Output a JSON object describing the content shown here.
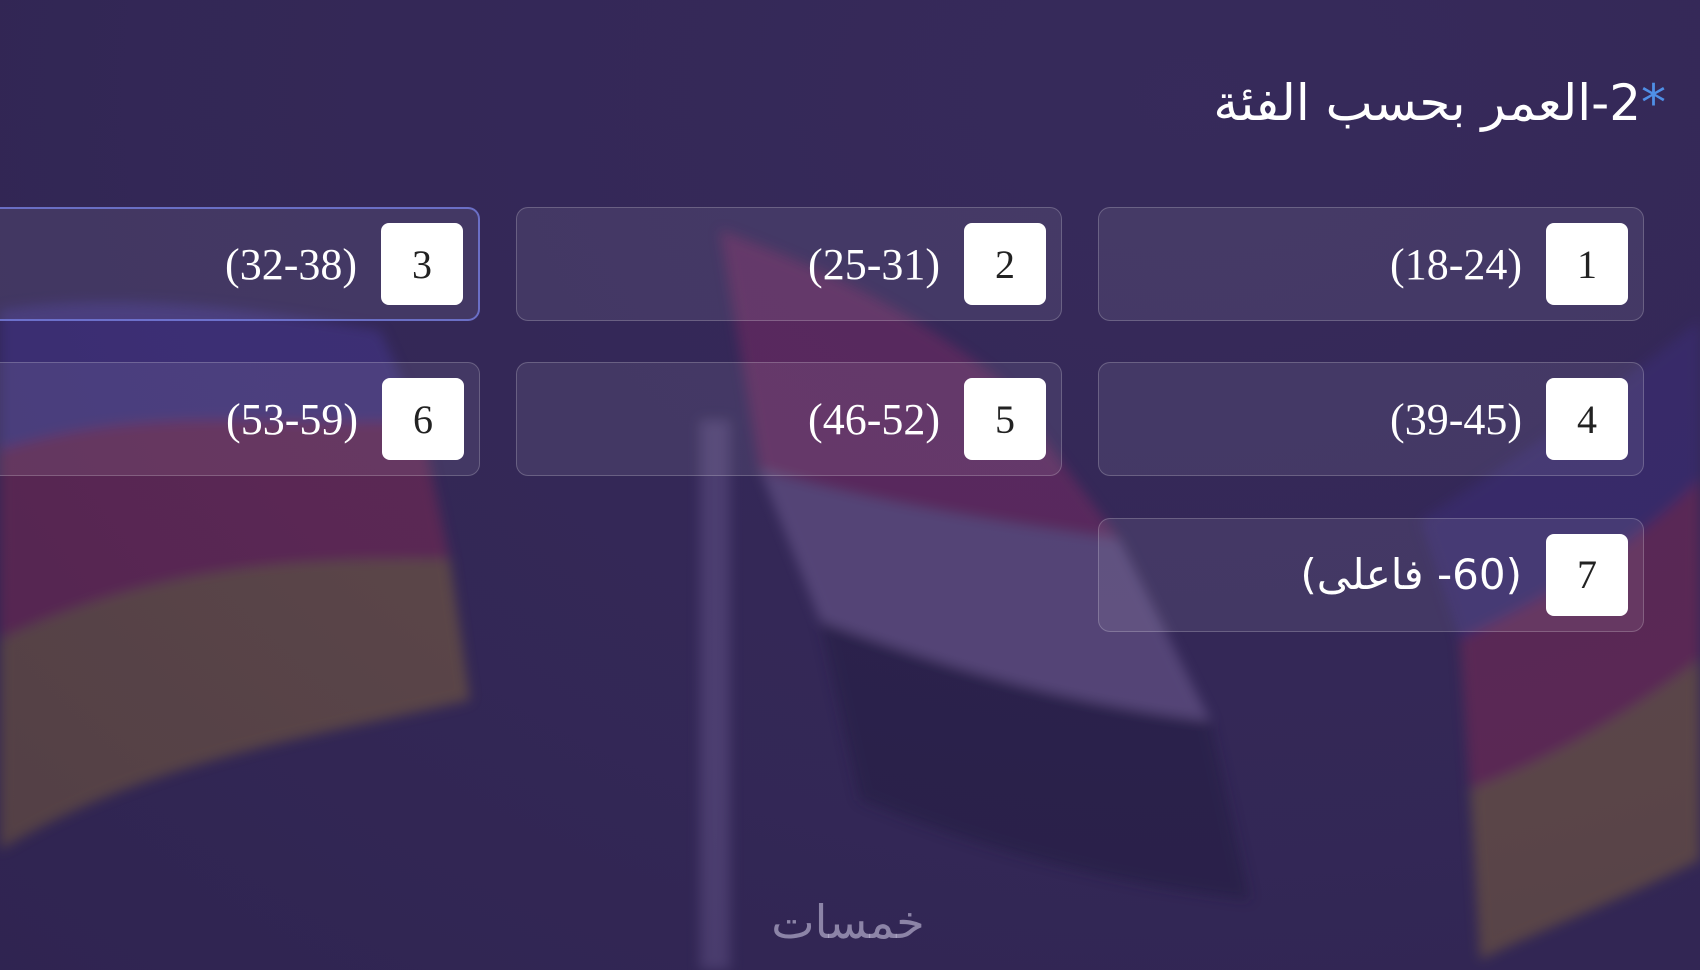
{
  "question": {
    "required_mark": "*",
    "number": "2-",
    "text": "العمر بحسب الفئة"
  },
  "options": [
    {
      "key": "1",
      "label": "(18-24)",
      "active": false
    },
    {
      "key": "2",
      "label": "(25-31)",
      "active": false
    },
    {
      "key": "3",
      "label": "(32-38)",
      "active": true
    },
    {
      "key": "4",
      "label": "(39-45)",
      "active": false
    },
    {
      "key": "5",
      "label": "(46-52)",
      "active": false
    },
    {
      "key": "6",
      "label": "(53-59)",
      "active": false
    },
    {
      "key": "7",
      "label": "(60- فاعلى)",
      "active": false
    }
  ],
  "watermark": {
    "text": "خمسات"
  },
  "colors": {
    "background": "#352958",
    "accent": "#4f8fe6",
    "key_bg": "#ffffff"
  },
  "background_image": "Iraqi flags waving (red, white, black)"
}
